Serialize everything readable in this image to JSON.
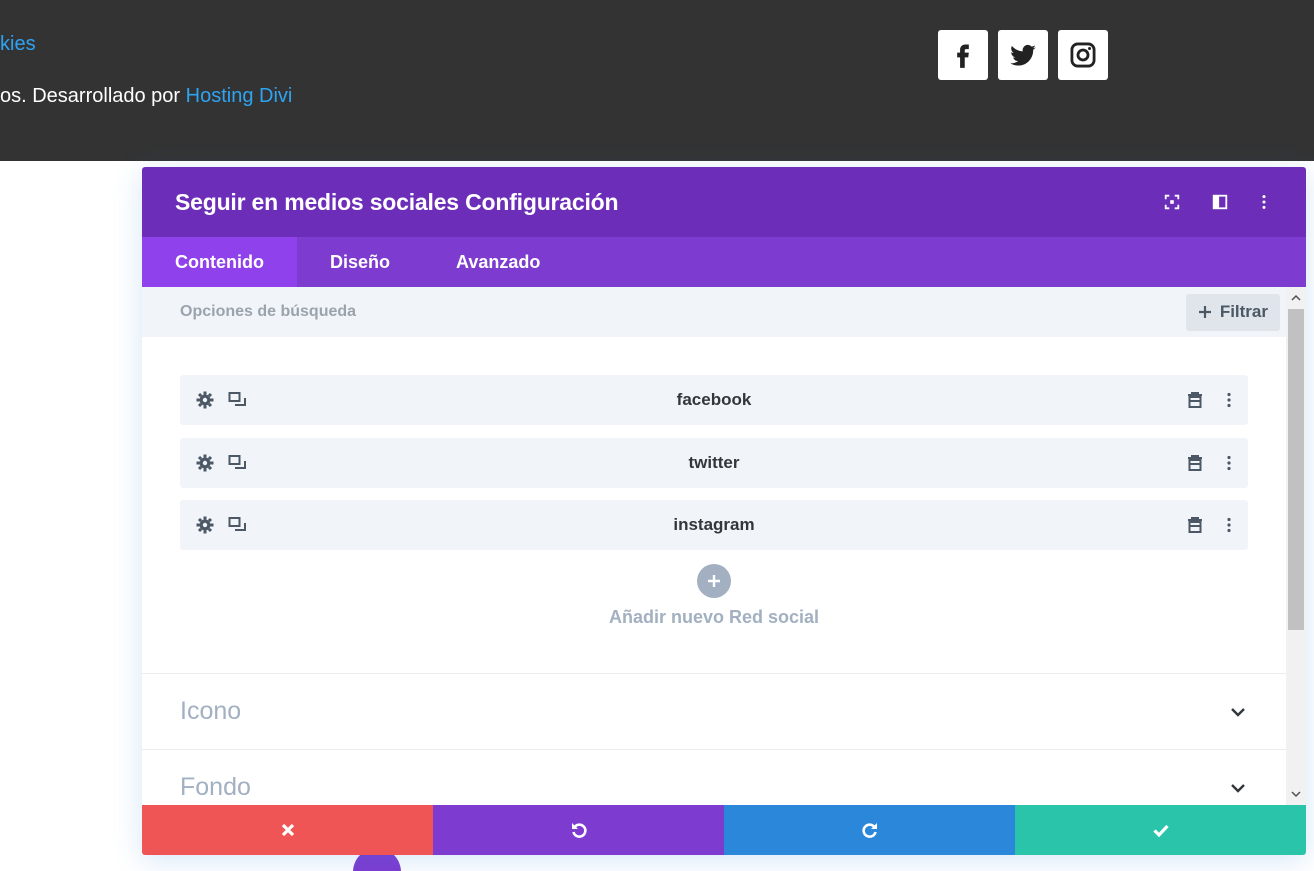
{
  "footer": {
    "link_text": "kies",
    "credit_prefix": "os. Desarrollado por ",
    "credit_link": "Hosting Divi",
    "social": [
      "facebook-icon",
      "twitter-icon",
      "instagram-icon"
    ]
  },
  "modal": {
    "title": "Seguir en medios sociales Configuración",
    "tabs": [
      {
        "label": "Contenido",
        "active": true
      },
      {
        "label": "Diseño",
        "active": false
      },
      {
        "label": "Avanzado",
        "active": false
      }
    ],
    "search": {
      "placeholder": "Opciones de búsqueda",
      "filter_label": "Filtrar"
    },
    "items": [
      {
        "label": "facebook"
      },
      {
        "label": "twitter"
      },
      {
        "label": "instagram"
      }
    ],
    "add_label": "Añadir nuevo Red social",
    "sections": [
      {
        "title": "Icono"
      },
      {
        "title": "Fondo"
      }
    ]
  },
  "colors": {
    "header": "#6c2eb9",
    "tabs": "#7e3bd0",
    "active_tab": "#8f42ec",
    "cancel": "#ef5555",
    "undo": "#7e3bd0",
    "redo": "#2b87da",
    "save": "#29c4a9"
  }
}
